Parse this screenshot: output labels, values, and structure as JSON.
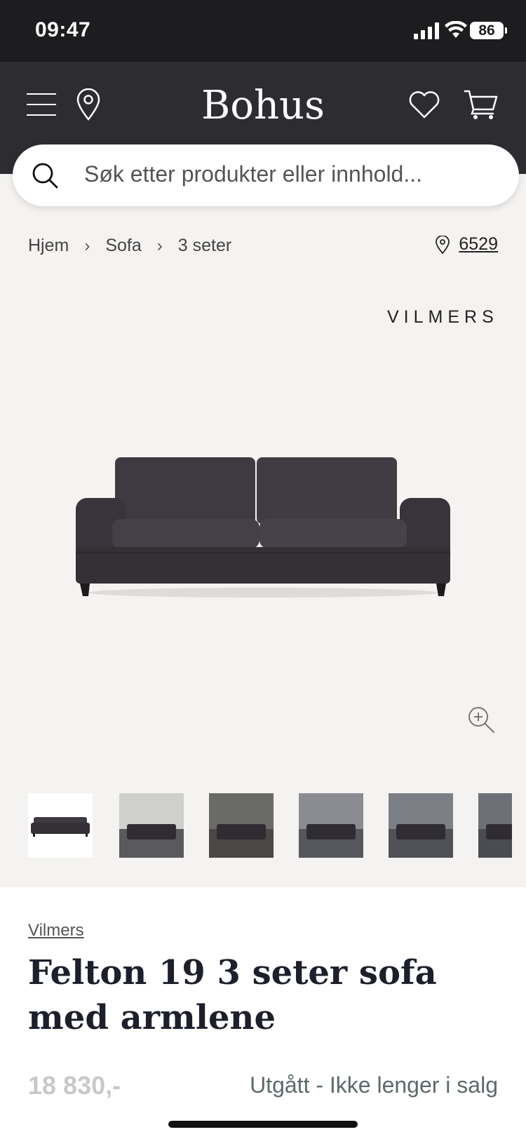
{
  "status_bar": {
    "time": "09:47",
    "battery": "86"
  },
  "header": {
    "logo": "Bohus"
  },
  "search": {
    "placeholder": "Søk etter produkter eller innhold..."
  },
  "breadcrumb": {
    "items": [
      "Hjem",
      "Sofa",
      "3 seter"
    ]
  },
  "store": {
    "number": "6529"
  },
  "gallery": {
    "brand_mark": "VILMERS",
    "thumbnail_count": 6
  },
  "product": {
    "brand": "Vilmers",
    "title": "Felton 19 3 seter sofa med armlene",
    "price": "18 830,-",
    "availability": "Utgått - Ikke lenger i salg"
  },
  "colors": {
    "header_bg": "#2d2d31",
    "page_bg": "#f5f3f1",
    "sofa": "#3a363d"
  }
}
